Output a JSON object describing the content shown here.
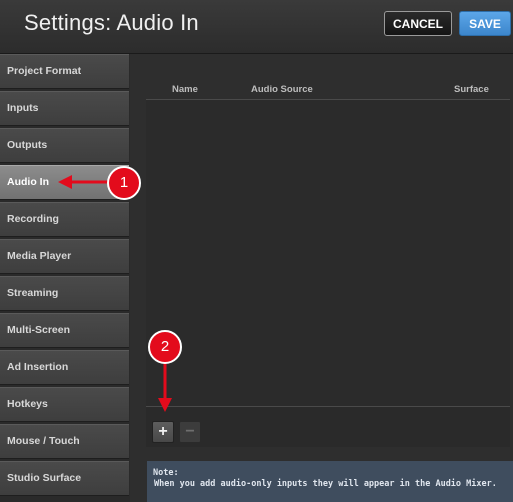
{
  "header": {
    "title": "Settings: Audio In",
    "cancel_label": "CANCEL",
    "save_label": "SAVE"
  },
  "sidebar": {
    "items": [
      {
        "label": "Project Format",
        "active": false
      },
      {
        "label": "Inputs",
        "active": false
      },
      {
        "label": "Outputs",
        "active": false
      },
      {
        "label": "Audio In",
        "active": true
      },
      {
        "label": "Recording",
        "active": false
      },
      {
        "label": "Media Player",
        "active": false
      },
      {
        "label": "Streaming",
        "active": false
      },
      {
        "label": "Multi-Screen",
        "active": false
      },
      {
        "label": "Ad Insertion",
        "active": false
      },
      {
        "label": "Hotkeys",
        "active": false
      },
      {
        "label": "Mouse / Touch",
        "active": false
      },
      {
        "label": "Studio Surface",
        "active": false
      }
    ]
  },
  "table": {
    "columns": [
      "Name",
      "Audio Source",
      "Surface"
    ],
    "rows": []
  },
  "controls": {
    "add_label": "+",
    "remove_label": "−"
  },
  "note": {
    "heading": "Note:",
    "text": "When you add audio-only inputs they will appear in the Audio Mixer."
  },
  "callouts": {
    "one": "1",
    "two": "2"
  },
  "colors": {
    "accent_blue": "#4a96dc",
    "callout_red": "#e30b1c",
    "active_item": "#808080",
    "note_bg": "#3f4d5e"
  }
}
